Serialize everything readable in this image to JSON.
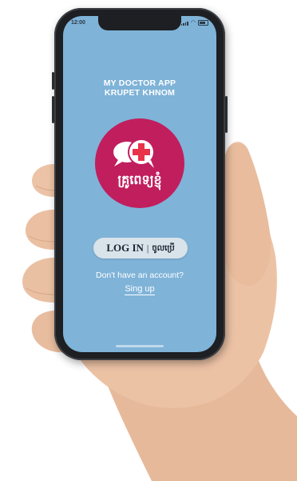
{
  "status_bar": {
    "time": "12:00",
    "icons": [
      "signal-icon",
      "wifi-icon",
      "battery-icon"
    ]
  },
  "app": {
    "title_line1": "MY DOCTOR APP",
    "title_line2": "KRUPET KHNOM",
    "logo_text": "គ្រូពេទ្យខ្ញុំ",
    "logo_icon": "chat-medical-cross-icon"
  },
  "login": {
    "label_en": "LOG IN",
    "separator": "|",
    "label_kh": "ចូលប្រើ"
  },
  "signup": {
    "prompt": "Don't have an account?",
    "link": "Sing up"
  },
  "colors": {
    "screen_bg": "#7fb3d8",
    "logo_bg": "#c11e5e",
    "cross": "#e8334a",
    "button_bg": "#d9e3ea"
  }
}
